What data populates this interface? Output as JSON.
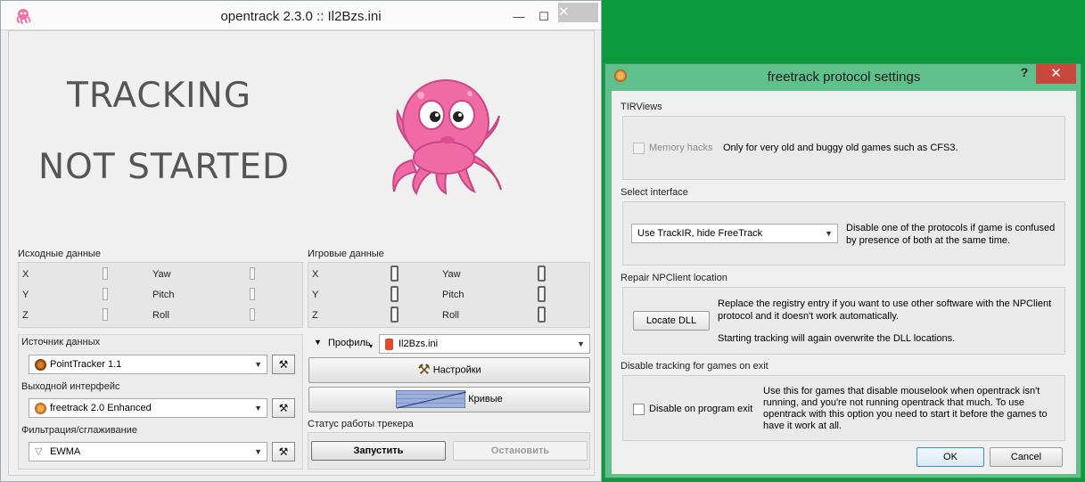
{
  "main_window": {
    "title": "opentrack 2.3.0 :: Il2Bzs.ini",
    "minimize_label": "—",
    "maximize_label": "☐",
    "close_label": "✕",
    "status_line1": "TRACKING",
    "status_line2": "NOT STARTED",
    "raw_data": {
      "heading": "Исходные данные",
      "axes": [
        "X",
        "Y",
        "Z",
        "Yaw",
        "Pitch",
        "Roll"
      ]
    },
    "game_data": {
      "heading": "Игровые данные",
      "axes": [
        "X",
        "Y",
        "Z",
        "Yaw",
        "Pitch",
        "Roll"
      ]
    },
    "tracker": {
      "heading": "Источник данных",
      "selected": "PointTracker 1.1",
      "icon": "pointtracker-icon"
    },
    "protocol": {
      "heading": "Выходной интерфейс",
      "selected": "freetrack 2.0 Enhanced",
      "icon": "freetrack-icon"
    },
    "filter": {
      "heading": "Фильтрация/сглаживание",
      "selected": "EWMA",
      "icon": "filter-funnel-icon"
    },
    "profile": {
      "label": "Профиль",
      "selected": "Il2Bzs.ini"
    },
    "settings_button": "Настройки",
    "curves_button": "Кривые",
    "tracker_status": {
      "heading": "Статус работы трекера",
      "start_button": "Запустить",
      "stop_button": "Остановить"
    }
  },
  "dialog": {
    "title": "freetrack protocol settings",
    "help_label": "?",
    "close_label": "✕",
    "tirviews": {
      "heading": "TIRViews",
      "checkbox_label": "Memory hacks",
      "description": "Only for very old and buggy old games such as CFS3."
    },
    "select_interface": {
      "heading": "Select interface",
      "selected": "Use TrackIR, hide FreeTrack",
      "description_line1": "Disable one of the protocols if game is confused",
      "description_line2": "by presence of both at the same time."
    },
    "repair_npclient": {
      "heading": "Repair NPClient location",
      "button": "Locate DLL",
      "description_line1": "Replace the registry entry if you want to use other software with the NPClient",
      "description_line2": "protocol and it doesn't work automatically.",
      "description_line3": "Starting tracking will again overwrite the DLL locations."
    },
    "disable_tracking": {
      "heading": "Disable tracking for games on exit",
      "checkbox_label": "Disable on program exit",
      "description_line1": "Use this for games that disable mouselook when opentrack isn't",
      "description_line2": "running, and you're not running opentrack that much. To use",
      "description_line3": "opentrack with this option you need to start it before the games to",
      "description_line4": "have it work at all."
    },
    "ok_button": "OK",
    "cancel_button": "Cancel"
  }
}
